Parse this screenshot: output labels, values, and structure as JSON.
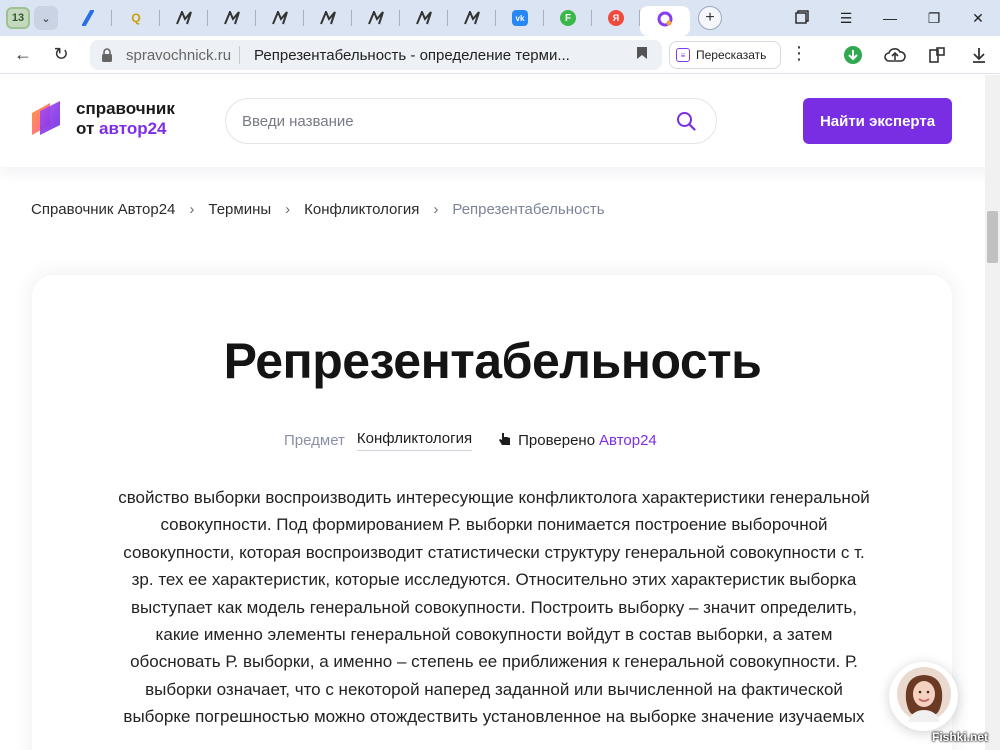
{
  "browser": {
    "tab_count": "13",
    "url_domain": "spravochnick.ru",
    "chrome_title": "Репрезентабельность - определение терми...",
    "retell_label": "Пересказать"
  },
  "header": {
    "logo_line1": "справочник",
    "logo_line2": "от",
    "logo_brand": "автор24",
    "search_placeholder": "Введи название",
    "expert_button": "Найти эксперта"
  },
  "breadcrumb": [
    "Справочник Автор24",
    "Термины",
    "Конфликтология",
    "Репрезентабельность"
  ],
  "article": {
    "title": "Репрезентабельность",
    "subject_label": "Предмет",
    "subject_value": "Конфликтология",
    "checked_label": "Проверено",
    "checked_by": "Автор24",
    "definition": "свойство выборки воспроизводить интересующие конфликтолога характеристики генеральной совокупности. Под формированием Р. выборки понимается построение выборочной совокупности, которая воспроизводит статистически структуру генеральной совокупности с т. зр. тех ее характеристик, которые исследуются. Относительно этих характеристик выборка выступает как модель генеральной совокупности. Построить выборку – значит определить, какие именно элементы генеральной совокупности войдут в состав выборки, а затем обосновать Р. выборки, а именно – степень ее приближения к генеральной совокупности. Р. выборки означает, что с некоторой наперед заданной или вычисленной на фактической выборке погрешностью можно отождествить установленное на выборке значение изучаемых"
  },
  "watermark": "Fishki.net",
  "colors": {
    "brand_purple": "#7a2ee3",
    "tabbar_bg": "#dbe4f3"
  }
}
